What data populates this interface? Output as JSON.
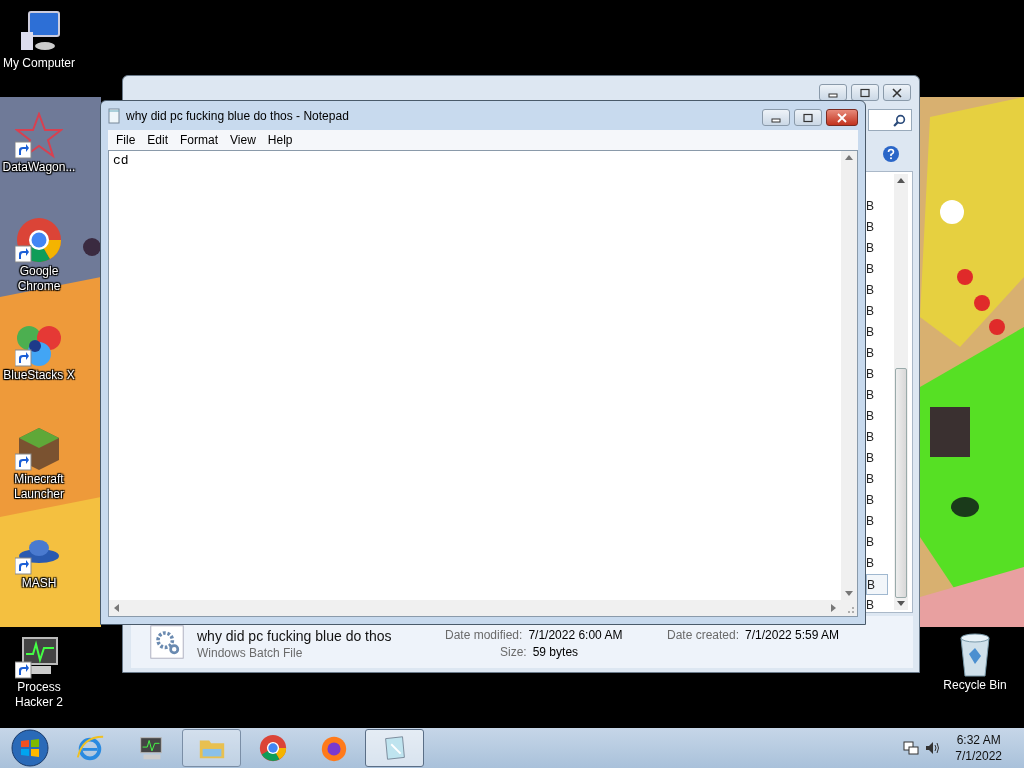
{
  "desktop": {
    "icons": [
      {
        "label": "My Computer",
        "kind": "computer",
        "shortcut": false
      },
      {
        "label": "DataWagon...",
        "kind": "star",
        "shortcut": true
      },
      {
        "label": "Google Chrome",
        "kind": "chrome",
        "shortcut": true
      },
      {
        "label": "BlueStacks X",
        "kind": "bluestacks",
        "shortcut": true
      },
      {
        "label": "Minecraft Launcher",
        "kind": "grass",
        "shortcut": true
      },
      {
        "label": "MASH",
        "kind": "ufo",
        "shortcut": true
      },
      {
        "label": "Process Hacker 2",
        "kind": "monitor",
        "shortcut": true
      }
    ],
    "recycle_bin": {
      "label": "Recycle Bin"
    }
  },
  "explorer": {
    "rows": [
      {
        "text": "B",
        "selected": false
      },
      {
        "text": "B",
        "selected": false
      },
      {
        "text": "B",
        "selected": false
      },
      {
        "text": "B",
        "selected": false
      },
      {
        "text": "B",
        "selected": false
      },
      {
        "text": "B",
        "selected": false
      },
      {
        "text": "B",
        "selected": false
      },
      {
        "text": "B",
        "selected": false
      },
      {
        "text": "B",
        "selected": false
      },
      {
        "text": "B",
        "selected": false
      },
      {
        "text": "B",
        "selected": false
      },
      {
        "text": "B",
        "selected": false
      },
      {
        "text": "B",
        "selected": false
      },
      {
        "text": "B",
        "selected": false
      },
      {
        "text": "B",
        "selected": false
      },
      {
        "text": "B",
        "selected": false
      },
      {
        "text": "B",
        "selected": false
      },
      {
        "text": "B",
        "selected": false
      },
      {
        "text": "B",
        "selected": true
      },
      {
        "text": "B",
        "selected": false
      }
    ],
    "details": {
      "name": "why did pc fucking blue do thos",
      "type": "Windows Batch File",
      "modified_label": "Date modified:",
      "modified": "7/1/2022 6:00 AM",
      "created_label": "Date created:",
      "created": "7/1/2022 5:59 AM",
      "size_label": "Size:",
      "size": "59 bytes"
    }
  },
  "notepad": {
    "title": "why did pc fucking blue do thos - Notepad",
    "menu": [
      "File",
      "Edit",
      "Format",
      "View",
      "Help"
    ],
    "text": "cd"
  },
  "taskbar": {
    "items": [
      {
        "kind": "ie",
        "open": false,
        "active": false
      },
      {
        "kind": "monitor",
        "open": false,
        "active": false
      },
      {
        "kind": "folder",
        "open": true,
        "active": false
      },
      {
        "kind": "chrome",
        "open": false,
        "active": false
      },
      {
        "kind": "firefox",
        "open": false,
        "active": false
      },
      {
        "kind": "notepad",
        "open": true,
        "active": true
      }
    ],
    "clock": {
      "time": "6:32 AM",
      "date": "7/1/2022"
    }
  }
}
